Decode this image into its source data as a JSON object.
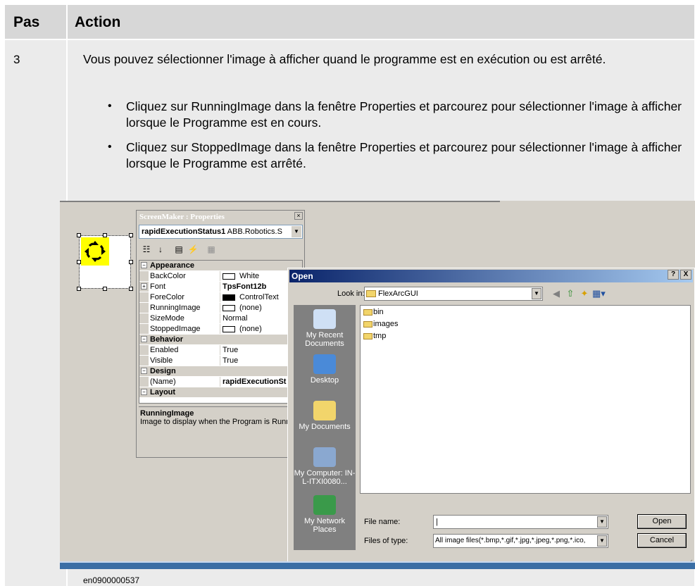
{
  "table": {
    "header_step": "Pas",
    "header_action": "Action",
    "step_number": "3",
    "intro": "Vous pouvez sélectionner l'image à afficher quand le programme est en exécution ou est arrêté.",
    "bullets": [
      "Cliquez sur RunningImage dans la fenêtre Properties et parcourez pour sélectionner l'image à afficher lorsque le Programme est en cours.",
      "Cliquez sur StoppedImage dans la fenêtre Properties et parcourez pour sélectionner l'image à afficher lorsque le Programme est arrêté."
    ],
    "figure_id": "en0900000537"
  },
  "properties_window": {
    "title": "ScreenMaker : Properties",
    "component_name": "rapidExecutionStatus1",
    "component_type": "ABB.Robotics.S",
    "grid": [
      {
        "kind": "category",
        "name": "Appearance"
      },
      {
        "kind": "prop",
        "name": "BackColor",
        "value": "White",
        "swatch": "#ffffff"
      },
      {
        "kind": "prop",
        "name": "Font",
        "value": "TpsFont12b",
        "bold": true,
        "expandable": true
      },
      {
        "kind": "prop",
        "name": "ForeColor",
        "value": "ControlText",
        "swatch": "#000000"
      },
      {
        "kind": "prop",
        "name": "RunningImage",
        "value": "(none)",
        "swatch": "#ffffff"
      },
      {
        "kind": "prop",
        "name": "SizeMode",
        "value": "Normal"
      },
      {
        "kind": "prop",
        "name": "StoppedImage",
        "value": "(none)",
        "swatch": "#ffffff"
      },
      {
        "kind": "category",
        "name": "Behavior"
      },
      {
        "kind": "prop",
        "name": "Enabled",
        "value": "True"
      },
      {
        "kind": "prop",
        "name": "Visible",
        "value": "True"
      },
      {
        "kind": "category",
        "name": "Design"
      },
      {
        "kind": "prop",
        "name": "(Name)",
        "value": "rapidExecutionSt",
        "bold": true
      },
      {
        "kind": "category",
        "name": "Layout"
      }
    ],
    "description_title": "RunningImage",
    "description_text": "Image to display when the Program is Running"
  },
  "open_dialog": {
    "title": "Open",
    "help_button": "?",
    "close_button": "X",
    "look_in_label": "Look in:",
    "look_in_value": "FlexArcGUI",
    "places": [
      {
        "icon": "recent-documents-icon",
        "label": "My Recent Documents"
      },
      {
        "icon": "desktop-icon",
        "label": "Desktop"
      },
      {
        "icon": "my-documents-icon",
        "label": "My Documents"
      },
      {
        "icon": "my-computer-icon",
        "label": "My Computer: IN-L-ITXI0080..."
      },
      {
        "icon": "network-places-icon",
        "label": "My Network Places"
      }
    ],
    "files": [
      "bin",
      "images",
      "tmp"
    ],
    "file_name_label": "File name:",
    "file_name_value": "",
    "files_of_type_label": "Files of type:",
    "files_of_type_value": "All image files(*.bmp,*.gif,*.jpg,*.jpeg,*.png,*.ico,",
    "open_button": "Open",
    "cancel_button": "Cancel"
  },
  "colors": {
    "table_header": "#d7d7d7",
    "table_body": "#ebebeb",
    "dialog_title_start": "#0a246a",
    "dialog_title_end": "#a6caf0",
    "control_highlight": "#ffff00"
  }
}
